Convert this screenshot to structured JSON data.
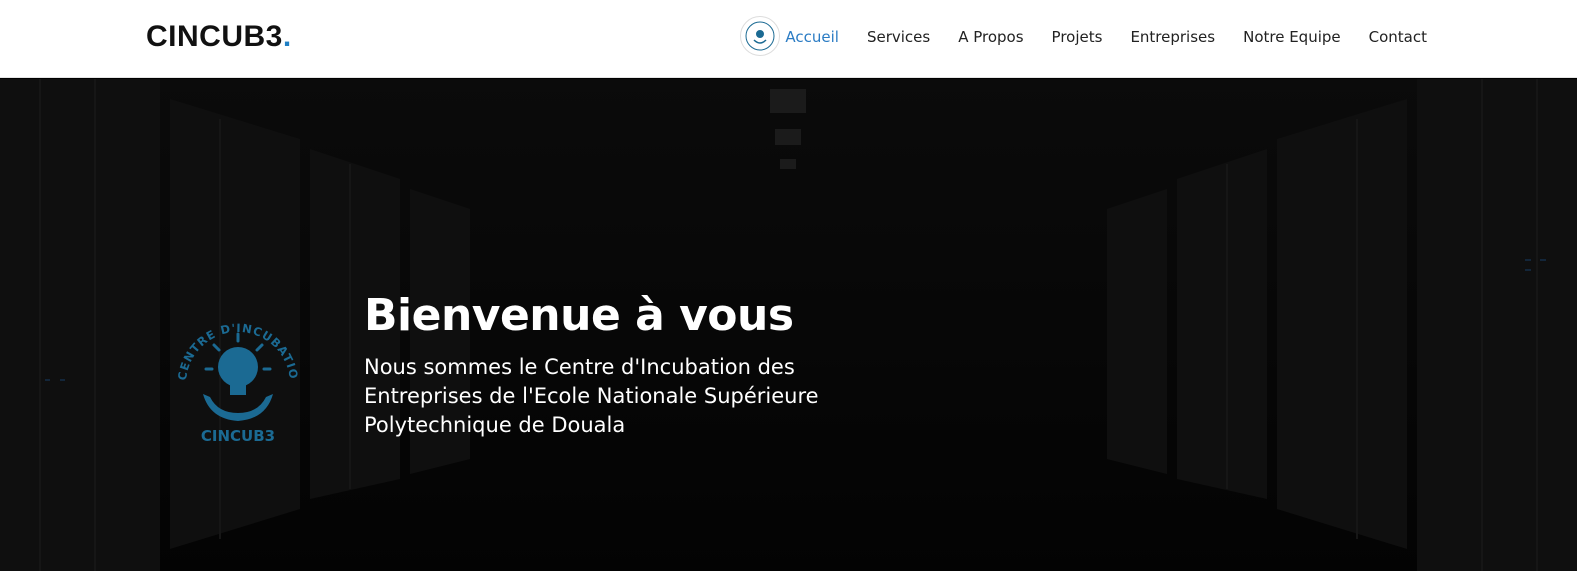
{
  "header": {
    "brand": "CINCUB3",
    "brand_dot": ".",
    "nav": [
      {
        "label": "Accueil",
        "active": true
      },
      {
        "label": "Services"
      },
      {
        "label": "A Propos"
      },
      {
        "label": "Projets"
      },
      {
        "label": "Entreprises"
      },
      {
        "label": "Notre Equipe"
      },
      {
        "label": "Contact"
      }
    ]
  },
  "hero": {
    "title": "Bienvenue à vous",
    "subtitle": "Nous sommes le Centre d'Incubation des Entreprises de l'Ecole Nationale Supérieure Polytechnique de Douala",
    "logo_ring_text": "CENTRE D'INCUBATION DES ENTREPRISES",
    "logo_text": "CINCUB3"
  },
  "colors": {
    "accent": "#1f7fc4",
    "nav_active": "#2b7cc4",
    "logo_blue": "#1b6a93"
  }
}
